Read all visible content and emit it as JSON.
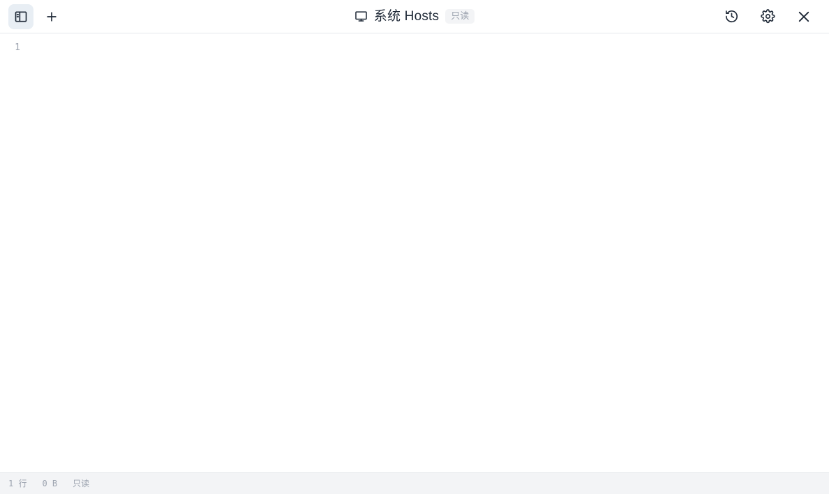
{
  "window": {
    "title_text": "系统 Hosts",
    "readonly_badge": "只读",
    "title_icon": "monitor-icon"
  },
  "toolbar": {
    "sidebar_toggle": {
      "icon": "panel-left-icon",
      "active": true
    },
    "new_tab": {
      "icon": "plus-icon",
      "label": "+"
    },
    "actions": [
      {
        "icon": "history-icon"
      },
      {
        "icon": "gear-icon"
      },
      {
        "icon": "close-icon"
      }
    ]
  },
  "editor": {
    "lines": [
      {
        "number": "1",
        "content": ""
      }
    ]
  },
  "statusbar": {
    "lines_count": "1 行",
    "file_size": "0 B",
    "mode": "只读"
  },
  "colors": {
    "accent_active_bg": "#e8eef4",
    "text_primary": "#1f2937",
    "text_muted": "#9ca3af",
    "border": "#e5e7eb",
    "statusbar_bg": "#f3f4f6",
    "badge_bg": "#f3f4f6",
    "editor_bg": "#ffffff"
  }
}
